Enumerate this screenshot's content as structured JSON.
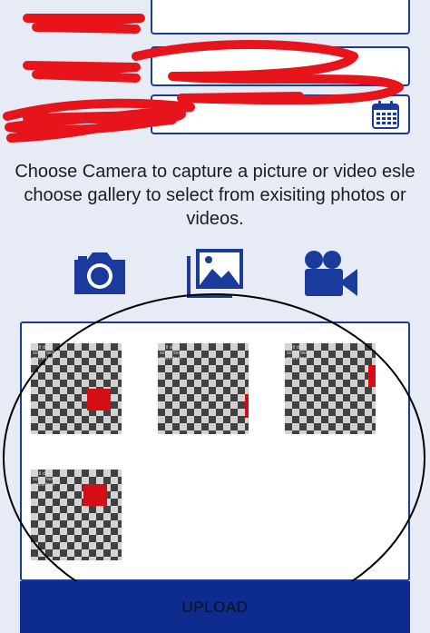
{
  "form": {
    "field_1_value": "",
    "field_2_value": "",
    "field_3_value": "",
    "calendar_icon": "calendar-icon"
  },
  "instructions": "Choose Camera to capture a picture or video esle choose gallery to select from exisiting photos or videos.",
  "media_buttons": [
    {
      "name": "camera",
      "icon": "camera-icon"
    },
    {
      "name": "gallery",
      "icon": "gallery-icon"
    },
    {
      "name": "video",
      "icon": "video-camera-icon"
    }
  ],
  "thumbnails": [
    {
      "caption": "Cell data\nsome text\nmore text"
    },
    {
      "caption": "Cell data\nsome text\nmore text"
    },
    {
      "caption": "Cell data\nsome text\nmore text"
    },
    {
      "caption": "Cell data\nsome text\nmore text"
    }
  ],
  "upload_button": {
    "label": "UPLOAD"
  },
  "colors": {
    "background": "#e7ebf6",
    "accent": "#1a3a9c",
    "upload_bar": "#0e2c8f",
    "redaction": "#e8141b"
  }
}
